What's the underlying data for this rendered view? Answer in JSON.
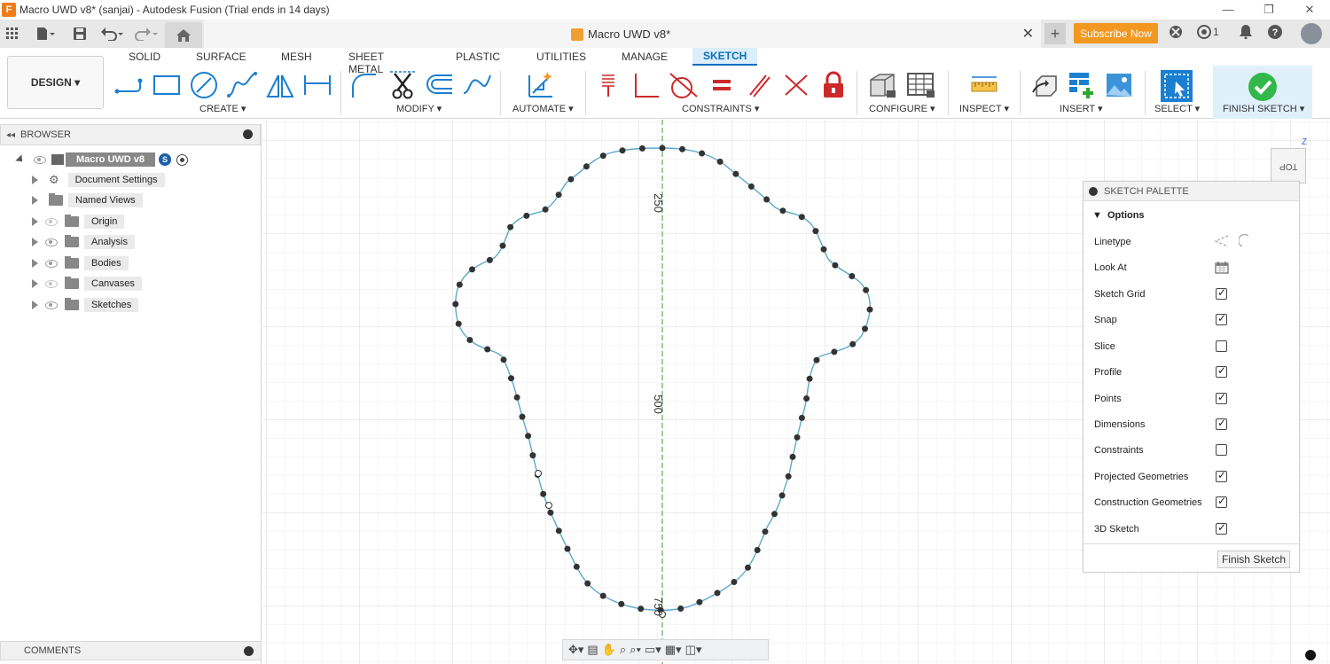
{
  "window": {
    "title": "Macro UWD v8* (sanjai) - Autodesk Fusion (Trial ends in 14 days)",
    "controls": [
      "—",
      "❐",
      "✕"
    ]
  },
  "qat": {
    "doc_tab_title": "Macro UWD v8*",
    "subscribe_label": "Subscribe Now",
    "notifications_count": "1"
  },
  "ribbon": {
    "workspace": "DESIGN",
    "tabs": [
      "SOLID",
      "SURFACE",
      "MESH",
      "SHEET METAL",
      "PLASTIC",
      "UTILITIES",
      "MANAGE",
      "SKETCH"
    ],
    "active_tab": "SKETCH",
    "groups": [
      "CREATE",
      "MODIFY",
      "AUTOMATE",
      "CONSTRAINTS",
      "CONFIGURE",
      "INSPECT",
      "INSERT",
      "SELECT",
      "FINISH SKETCH"
    ],
    "accent": "#0a6fbd"
  },
  "browser": {
    "header": "BROWSER",
    "root": "Macro UWD v8",
    "items": [
      "Document Settings",
      "Named Views",
      "Origin",
      "Analysis",
      "Bodies",
      "Canvases",
      "Sketches"
    ]
  },
  "comments": {
    "label": "COMMENTS"
  },
  "canvas": {
    "dimension_labels": [
      "250",
      "500",
      "750"
    ],
    "curve_color": "#5aa9cc",
    "axis_color": "#3a9a3a"
  },
  "viewcube": {
    "face_label": "TOP"
  },
  "palette": {
    "header": "SKETCH PALETTE",
    "section": "Options",
    "rows": [
      {
        "label": "Linetype",
        "type": "icon"
      },
      {
        "label": "Look At",
        "type": "icon"
      },
      {
        "label": "Sketch Grid",
        "checked": true
      },
      {
        "label": "Snap",
        "checked": true
      },
      {
        "label": "Slice",
        "checked": false
      },
      {
        "label": "Profile",
        "checked": true
      },
      {
        "label": "Points",
        "checked": true
      },
      {
        "label": "Dimensions",
        "checked": true
      },
      {
        "label": "Constraints",
        "checked": false
      },
      {
        "label": "Projected Geometries",
        "checked": true
      },
      {
        "label": "Construction Geometries",
        "checked": true
      },
      {
        "label": "3D Sketch",
        "checked": true
      }
    ],
    "finish_label": "Finish Sketch"
  }
}
